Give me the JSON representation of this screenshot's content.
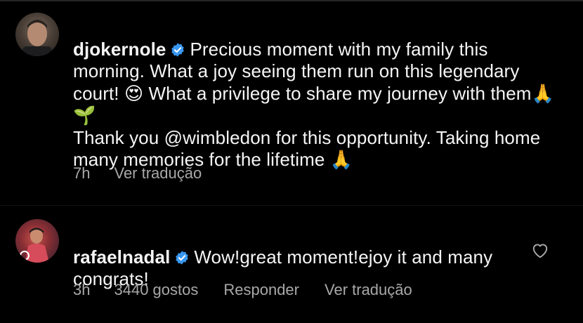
{
  "comments": [
    {
      "username": "djokernole",
      "verified": true,
      "text": "Precious moment with my family this morning. What a joy seeing them run on this legendary court! 😍 What a privilege to share my journey with them🙏🌱\nThank you @wimbledon for this opportunity. Taking home many memories for the lifetime 🙏",
      "time": "7h",
      "translate_label": "Ver tradução"
    },
    {
      "username": "rafaelnadal",
      "verified": true,
      "text": "Wow!great moment!ejoy it and many congrats!",
      "time": "3h",
      "likes": "3440 gostos",
      "reply_label": "Responder",
      "translate_label": "Ver tradução"
    }
  ],
  "icons": {
    "verified": "verified-badge-icon",
    "like": "heart-icon"
  },
  "colors": {
    "background": "#000000",
    "text": "#f5f5f5",
    "meta": "#a8a8a8",
    "verified": "#3897f0"
  }
}
